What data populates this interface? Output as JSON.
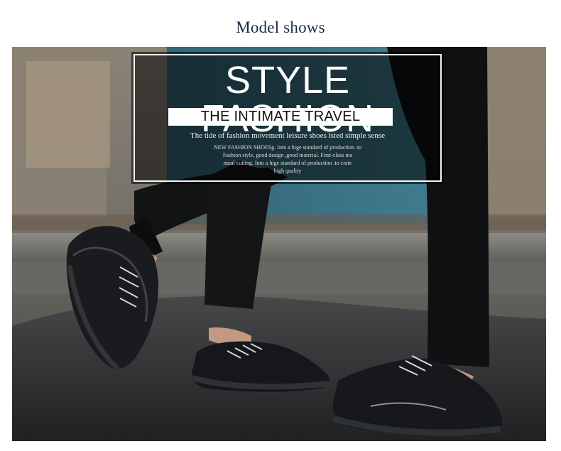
{
  "header": {
    "title": "Model shows"
  },
  "overlay": {
    "title": "STYLE FASHION",
    "subtitle": "THE INTIMATE TRAVEL",
    "sense_line": "The tide of fashion movement leisure shoes lsted simple sense",
    "small_lines": [
      "NEW FASHION SHOESg. Into a hige standard of production .to",
      "Fashion style, good design ,good material. First-class ma",
      "mual cuiting. Into a hige standard of production .to crate",
      "high quality"
    ]
  },
  "colors": {
    "header_text": "#1c2a4a",
    "overlay_fill": "#000000",
    "overlay_border": "#ffffff",
    "subtitle_fill": "#ffffff"
  }
}
